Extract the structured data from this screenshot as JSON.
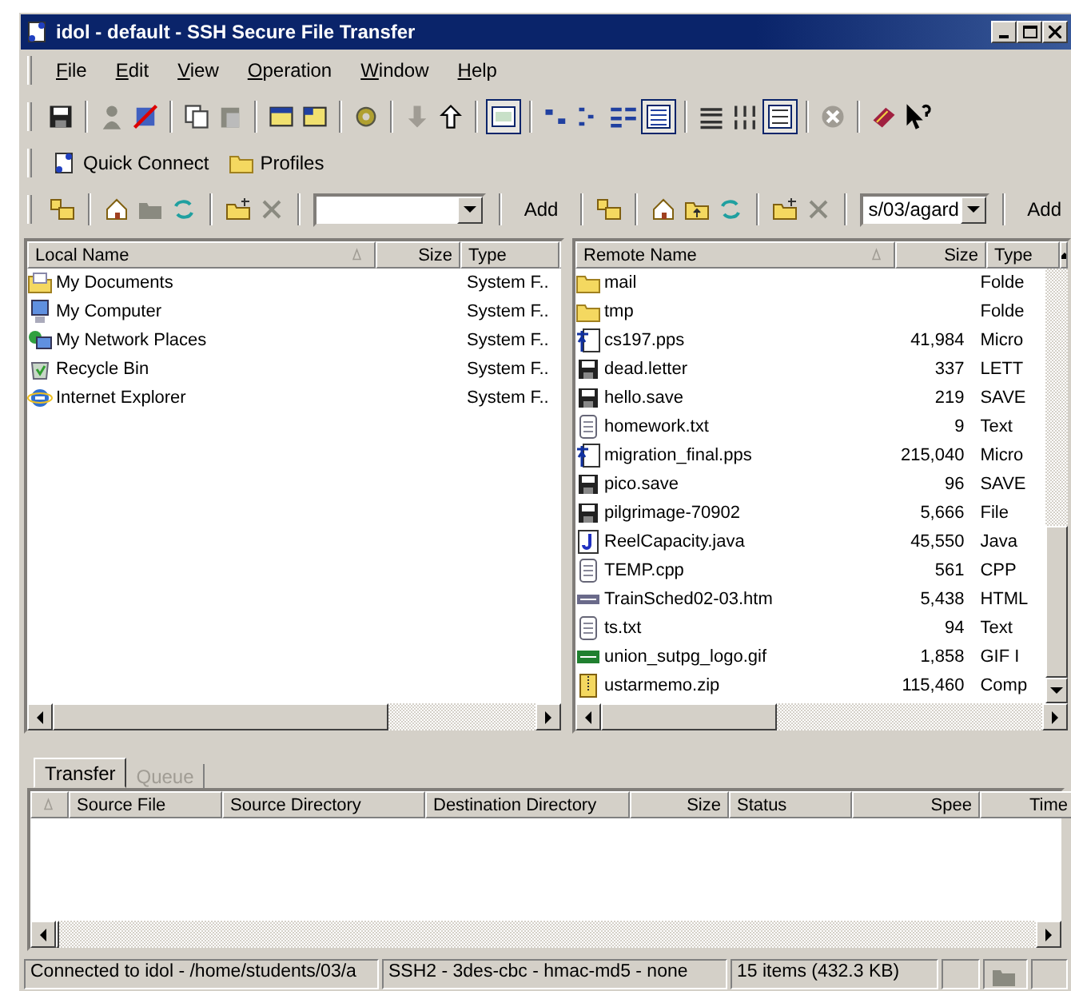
{
  "window": {
    "title": "idol - default - SSH Secure File Transfer"
  },
  "menu": [
    {
      "label": "File"
    },
    {
      "label": "Edit"
    },
    {
      "label": "View"
    },
    {
      "label": "Operation"
    },
    {
      "label": "Window"
    },
    {
      "label": "Help"
    }
  ],
  "shortcuts": [
    {
      "kind": "connect",
      "label": "Quick Connect"
    },
    {
      "kind": "folder",
      "label": "Profiles"
    }
  ],
  "local_toolbar": {
    "add_label": "Add"
  },
  "remote_toolbar": {
    "address": "s/03/agard",
    "add_label": "Add"
  },
  "local_pane": {
    "columns": [
      "Local Name",
      "Size",
      "Type"
    ],
    "rows": [
      {
        "kind": "documents",
        "name": "My Documents",
        "type": "System F.."
      },
      {
        "kind": "computer",
        "name": "My Computer",
        "type": "System F.."
      },
      {
        "kind": "network",
        "name": "My Network Places",
        "type": "System F.."
      },
      {
        "kind": "recycle",
        "name": "Recycle Bin",
        "type": "System F.."
      },
      {
        "kind": "browser",
        "name": "Internet Explorer",
        "type": "System F.."
      }
    ]
  },
  "remote_pane": {
    "columns": [
      "Remote Name",
      "Size",
      "Type"
    ],
    "rows": [
      {
        "kind": "folder",
        "name": "mail",
        "type": "Folde"
      },
      {
        "kind": "folder",
        "name": "tmp",
        "type": "Folde"
      },
      {
        "kind": "presentation",
        "name": "cs197.pps",
        "size": "41,984",
        "type": "Micro"
      },
      {
        "kind": "save",
        "name": "dead.letter",
        "size": "337",
        "type": "LETT"
      },
      {
        "kind": "save",
        "name": "hello.save",
        "size": "219",
        "type": "SAVE"
      },
      {
        "kind": "text",
        "name": "homework.txt",
        "size": "9",
        "type": "Text"
      },
      {
        "kind": "presentation",
        "name": "migration_final.pps",
        "size": "215,040",
        "type": "Micro"
      },
      {
        "kind": "save",
        "name": "pico.save",
        "size": "96",
        "type": "SAVE"
      },
      {
        "kind": "save",
        "name": "pilgrimage-70902",
        "size": "5,666",
        "type": "File"
      },
      {
        "kind": "java",
        "name": "ReelCapacity.java",
        "size": "45,550",
        "type": "Java"
      },
      {
        "kind": "text",
        "name": "TEMP.cpp",
        "size": "561",
        "type": "CPP"
      },
      {
        "kind": "html",
        "name": "TrainSched02-03.htm",
        "size": "5,438",
        "type": "HTML"
      },
      {
        "kind": "text",
        "name": "ts.txt",
        "size": "94",
        "type": "Text"
      },
      {
        "kind": "gif",
        "name": "union_sutpg_logo.gif",
        "size": "1,858",
        "type": "GIF I"
      },
      {
        "kind": "zip",
        "name": "ustarmemo.zip",
        "size": "115,460",
        "type": "Comp"
      }
    ]
  },
  "transfer": {
    "tabs": [
      {
        "label": "Transfer",
        "selected": true
      },
      {
        "label": "Queue",
        "selected": false
      }
    ],
    "columns": [
      "Source File",
      "Source Directory",
      "Destination Directory",
      "Size",
      "Status",
      "Spee",
      "Time"
    ]
  },
  "status_bar": [
    "Connected to idol - /home/students/03/a",
    "SSH2 - 3des-cbc - hmac-md5 - none",
    "15 items (432.3 KB)"
  ]
}
